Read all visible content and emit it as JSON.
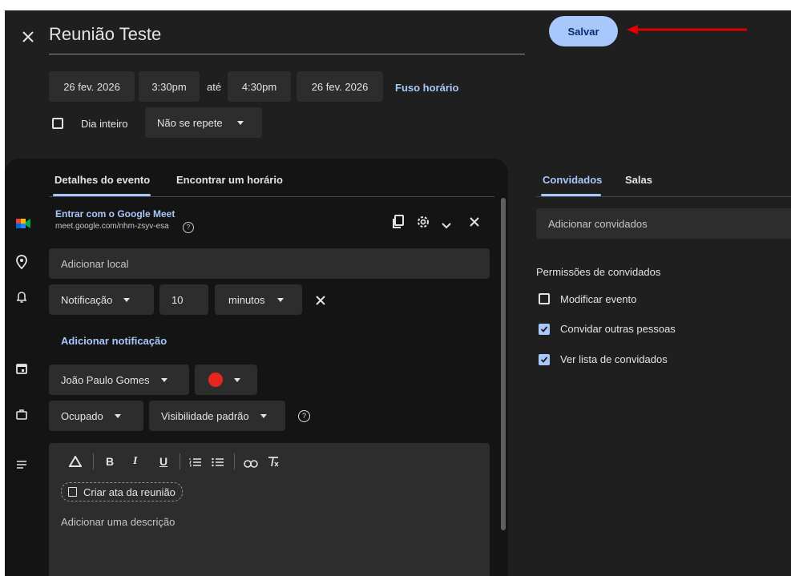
{
  "colors": {
    "background": "#1f1f1f",
    "accent": "#a8c7fa",
    "field": "#2d2d2d",
    "event_color": "#e5261f",
    "annotation_arrow": "#e00000"
  },
  "header": {
    "close_icon": "close-icon",
    "title": "Reunião Teste",
    "save_label": "Salvar"
  },
  "datetime": {
    "start_date": "26 fev. 2026",
    "start_time": "3:30pm",
    "until": "até",
    "end_time": "4:30pm",
    "end_date": "26 fev. 2026",
    "timezone_link": "Fuso horário"
  },
  "options": {
    "all_day_label": "Dia inteiro",
    "all_day_checked": false,
    "repeat_value": "Não se repete"
  },
  "tabs": {
    "details": "Detalhes do evento",
    "find_time": "Encontrar um horário"
  },
  "meet": {
    "title": "Entrar com o Google Meet",
    "url": "meet.google.com/nhm-zsyv-esa"
  },
  "location": {
    "placeholder": "Adicionar local"
  },
  "notification": {
    "type": "Notificação",
    "amount": "10",
    "unit": "minutos",
    "add_link": "Adicionar notificação"
  },
  "calendar": {
    "owner": "João Paulo Gomes"
  },
  "availability": {
    "status": "Ocupado",
    "visibility": "Visibilidade padrão"
  },
  "description": {
    "toolbar": [
      "drive-icon",
      "bold-icon",
      "italic-icon",
      "underline-icon",
      "numbered-list-icon",
      "bulleted-list-icon",
      "link-icon",
      "clear-format-icon"
    ],
    "notes_button": "Criar ata da reunião",
    "placeholder": "Adicionar uma descrição"
  },
  "guests_panel": {
    "tabs": {
      "guests": "Convidados",
      "rooms": "Salas"
    },
    "add_placeholder": "Adicionar convidados",
    "permissions_title": "Permissões de convidados",
    "permissions": [
      {
        "label": "Modificar evento",
        "checked": false
      },
      {
        "label": "Convidar outras pessoas",
        "checked": true
      },
      {
        "label": "Ver lista de convidados",
        "checked": true
      }
    ]
  }
}
